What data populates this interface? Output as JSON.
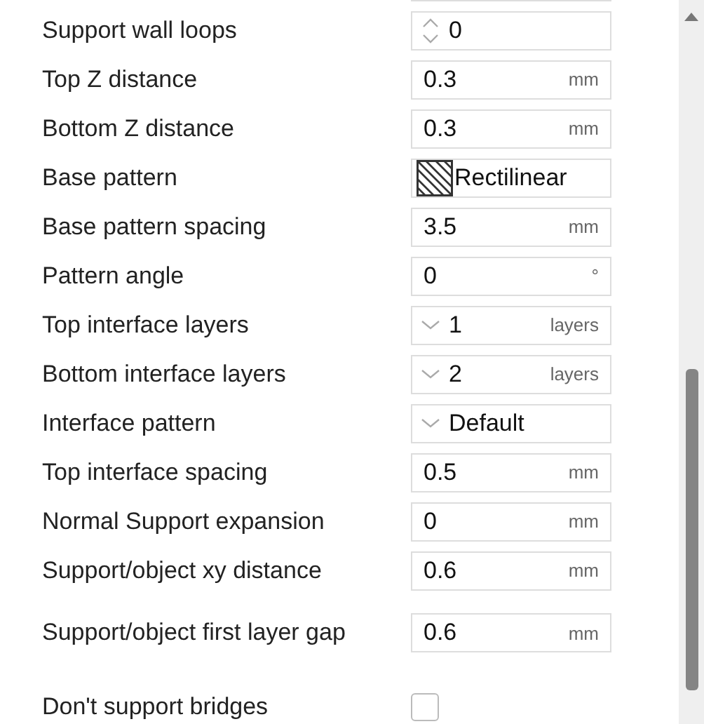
{
  "settings": [
    {
      "label": "Support wall loops",
      "kind": "spin",
      "value": "0"
    },
    {
      "label": "Top Z distance",
      "kind": "number",
      "value": "0.3",
      "unit": "mm"
    },
    {
      "label": "Bottom Z distance",
      "kind": "number",
      "value": "0.3",
      "unit": "mm"
    },
    {
      "label": "Base pattern",
      "kind": "pattern",
      "value": "Rectilinear"
    },
    {
      "label": "Base pattern spacing",
      "kind": "number",
      "value": "3.5",
      "unit": "mm"
    },
    {
      "label": "Pattern angle",
      "kind": "number",
      "value": "0",
      "unit": "°"
    },
    {
      "label": "Top interface layers",
      "kind": "combo",
      "value": "1",
      "unit": "layers"
    },
    {
      "label": "Bottom interface layers",
      "kind": "combo",
      "value": "2",
      "unit": "layers"
    },
    {
      "label": "Interface pattern",
      "kind": "combo",
      "value": "Default"
    },
    {
      "label": "Top interface spacing",
      "kind": "number",
      "value": "0.5",
      "unit": "mm"
    },
    {
      "label": "Normal Support expansion",
      "kind": "number",
      "value": "0",
      "unit": "mm"
    },
    {
      "label": "Support/object xy distance",
      "kind": "number",
      "value": "0.6",
      "unit": "mm"
    },
    {
      "label": "Support/object first layer gap",
      "kind": "number",
      "value": "0.6",
      "unit": "mm"
    },
    {
      "label": "Don't support bridges",
      "kind": "checkbox",
      "checked": false
    }
  ]
}
